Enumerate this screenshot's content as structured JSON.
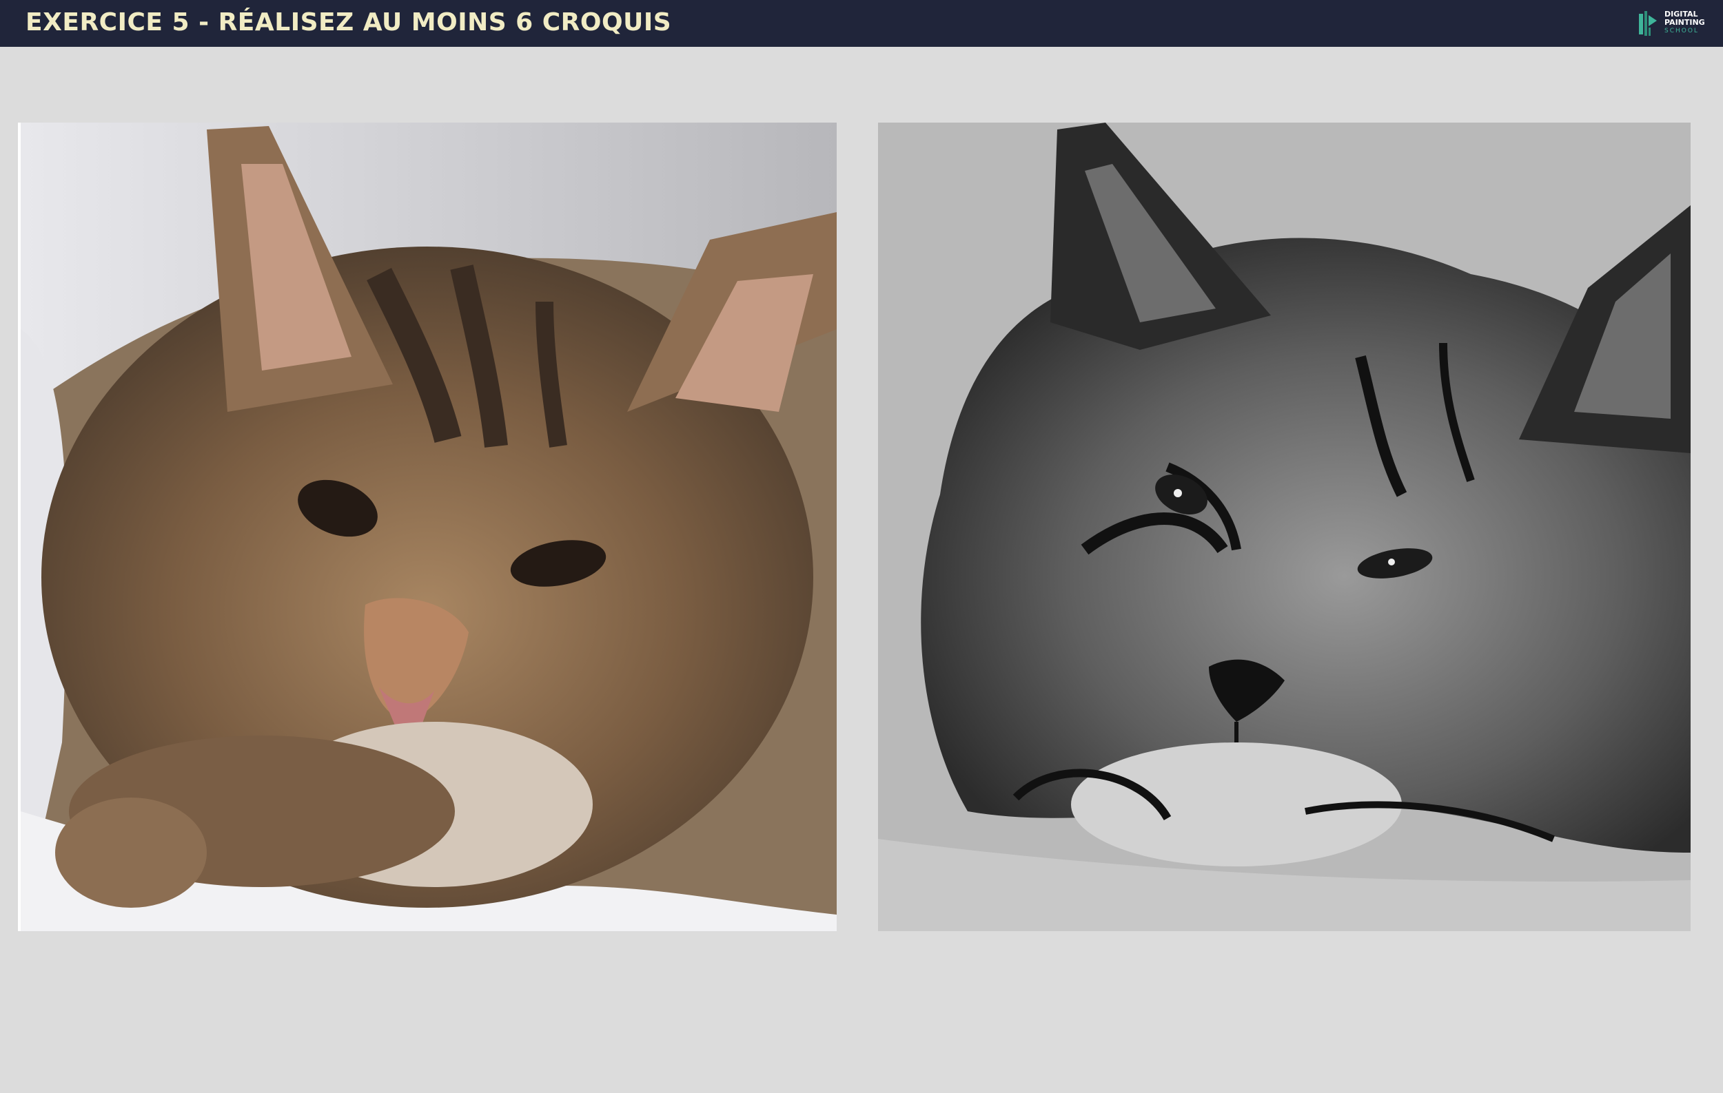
{
  "header": {
    "title": "EXERCICE 5 - RÉALISEZ AU MOINS 6 CROQUIS",
    "background": "#20253a",
    "title_color": "#f1ecc4"
  },
  "logo": {
    "line1": "DIGITAL",
    "line2": "PAINTING",
    "line3": "SCHOOL",
    "accent": "#3fb59a"
  },
  "page": {
    "background": "#dcdcdc"
  },
  "images": [
    {
      "name": "reference-photo",
      "description_icon": "kitten-photo"
    },
    {
      "name": "sketch-drawing",
      "description_icon": "kitten-sketch"
    }
  ]
}
